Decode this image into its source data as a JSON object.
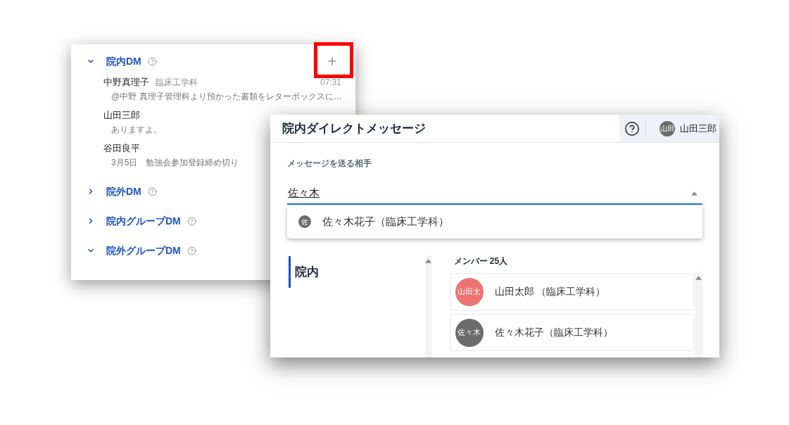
{
  "dm_panel": {
    "sections": [
      {
        "title": "院内DM",
        "expanded": true,
        "add_button": {
          "highlighted": true
        },
        "items": [
          {
            "name": "中野真理子",
            "department": "臨床工学科",
            "preview": "@中野 真理子管理科より預かった書類をレターボックスに…",
            "time": "07:31"
          },
          {
            "name": "山田三郎",
            "preview": "ありますよ。"
          },
          {
            "name": "谷田良平",
            "preview": "3月5日　勉強会参加登録締め切り"
          }
        ]
      },
      {
        "title": "院外DM",
        "expanded": false
      },
      {
        "title": "院内グループDM",
        "expanded": false
      },
      {
        "title": "院外グループDM",
        "expanded": true
      }
    ]
  },
  "dialog": {
    "title": "院内ダイレクトメッセージ",
    "user": {
      "initials": "山田",
      "name": "山田三郎"
    },
    "recipient_field": {
      "label": "メッセージを送る相手",
      "value": "佐々木"
    },
    "suggestions": [
      {
        "initials": "佐",
        "label": "佐々木花子（臨床工学科）"
      }
    ],
    "category_tabs": [
      {
        "label": "院内",
        "selected": true
      }
    ],
    "member_list": {
      "heading": "メンバー 25人",
      "members": [
        {
          "initials": "山田太",
          "name": "山田太郎 （臨床工学科）",
          "color": "#ee7272"
        },
        {
          "initials": "佐々木",
          "name": "佐々木花子（臨床工学科）",
          "color": "#6b6b6b"
        }
      ]
    }
  }
}
